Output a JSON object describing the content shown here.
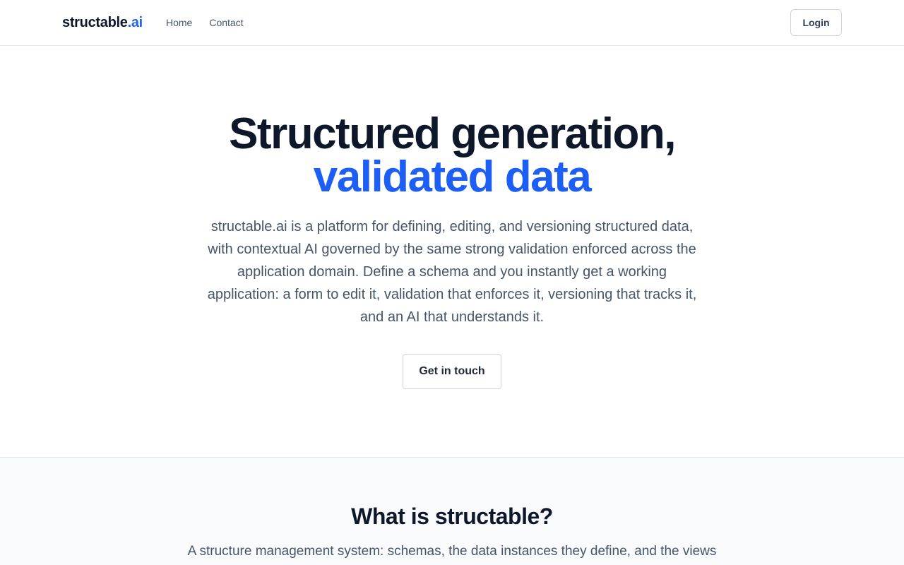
{
  "nav": {
    "brand_main": "structable",
    "brand_accent": ".ai",
    "links": [
      "Home",
      "Contact"
    ],
    "login_label": "Login"
  },
  "hero": {
    "title_line1": "Structured generation,",
    "title_line2": "validated data",
    "description": "structable.ai is a platform for defining, editing, and versioning structured data, with contextual AI governed by the same strong validation enforced across the application domain. Define a schema and you instantly get a working application: a form to edit it, validation that enforces it, versioning that tracks it, and an AI that understands it.",
    "cta_label": "Get in touch"
  },
  "about": {
    "title": "What is structable?",
    "text": "A structure management system: schemas, the data instances they define, and the views"
  },
  "colors": {
    "accent": "#2563eb",
    "heading": "#0f172a",
    "body_text": "#475569",
    "section_bg": "#f8fafc"
  }
}
